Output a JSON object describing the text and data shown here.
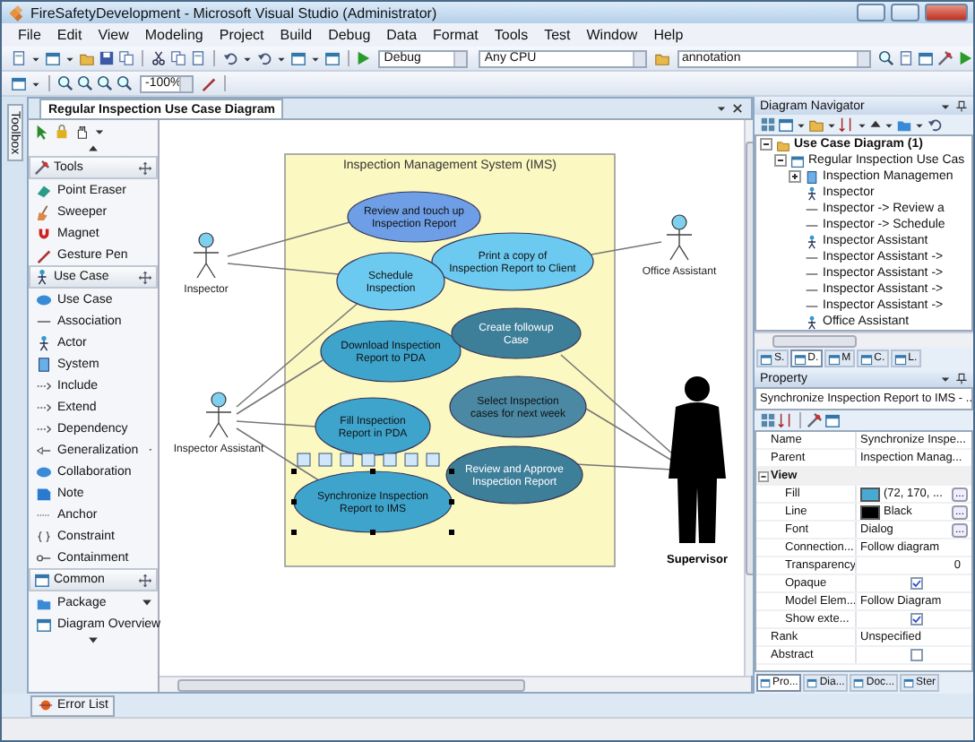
{
  "window": {
    "title": "FireSafetyDevelopment - Microsoft Visual Studio (Administrator)"
  },
  "menu": [
    "File",
    "Edit",
    "View",
    "Modeling",
    "Project",
    "Build",
    "Debug",
    "Data",
    "Format",
    "Tools",
    "Test",
    "Window",
    "Help"
  ],
  "toolbar": {
    "configuration": "Debug",
    "platform": "Any CPU",
    "find": "annotation",
    "zoom": "-100%"
  },
  "toolbox_tab": "Toolbox",
  "document_tab": {
    "title": "Regular Inspection Use Case Diagram"
  },
  "palette": {
    "sections": [
      {
        "title": "Tools",
        "items": [
          {
            "label": "Point Eraser",
            "has_submenu": false
          },
          {
            "label": "Sweeper",
            "has_submenu": false
          },
          {
            "label": "Magnet",
            "has_submenu": false
          },
          {
            "label": "Gesture Pen",
            "has_submenu": false
          }
        ]
      },
      {
        "title": "Use Case",
        "items": [
          {
            "label": "Use Case",
            "has_submenu": false
          },
          {
            "label": "Association",
            "has_submenu": false
          },
          {
            "label": "Actor",
            "has_submenu": false
          },
          {
            "label": "System",
            "has_submenu": false
          },
          {
            "label": "Include",
            "has_submenu": false
          },
          {
            "label": "Extend",
            "has_submenu": false
          },
          {
            "label": "Dependency",
            "has_submenu": false
          },
          {
            "label": "Generalization",
            "has_submenu": true
          },
          {
            "label": "Collaboration",
            "has_submenu": false
          },
          {
            "label": "Note",
            "has_submenu": false
          },
          {
            "label": "Anchor",
            "has_submenu": false
          },
          {
            "label": "Constraint",
            "has_submenu": false
          },
          {
            "label": "Containment",
            "has_submenu": false
          }
        ]
      },
      {
        "title": "Common",
        "items": [
          {
            "label": "Package",
            "has_submenu": true
          },
          {
            "label": "Diagram Overview",
            "has_submenu": false
          }
        ]
      }
    ]
  },
  "diagram": {
    "system_title": "Inspection Management System (IMS)",
    "use_cases": [
      {
        "lines": [
          "Review and touch up",
          "Inspection Report"
        ],
        "color": "#6e9ee6",
        "selected": false
      },
      {
        "lines": [
          "Print a copy of",
          "Inspection Report to Client"
        ],
        "color": "#6ccaf0",
        "selected": false
      },
      {
        "lines": [
          "Schedule",
          "Inspection"
        ],
        "color": "#6ccaf0",
        "selected": false
      },
      {
        "lines": [
          "Download Inspection",
          "Report to PDA"
        ],
        "color": "#3ea4cc",
        "selected": false
      },
      {
        "lines": [
          "Create followup",
          "Case"
        ],
        "color": "#3d7e99",
        "selected": false
      },
      {
        "lines": [
          "Select Inspection",
          "cases for next week"
        ],
        "color": "#4a88a3",
        "selected": false
      },
      {
        "lines": [
          "Fill Inspection",
          "Report in PDA"
        ],
        "color": "#3ea4cc",
        "selected": false
      },
      {
        "lines": [
          "Review and Approve",
          "Inspection Report"
        ],
        "color": "#3d7e99",
        "selected": false
      },
      {
        "lines": [
          "Synchronize Inspection",
          "Report to IMS"
        ],
        "color": "#3ea4cc",
        "selected": true
      }
    ],
    "actors": [
      {
        "name": "Inspector",
        "kind": "stick"
      },
      {
        "name": "Inspector Assistant",
        "kind": "stick"
      },
      {
        "name": "Office Assistant",
        "kind": "stick"
      },
      {
        "name": "Supervisor",
        "kind": "silhouette"
      }
    ]
  },
  "navigator": {
    "title": "Diagram Navigator",
    "tree": [
      {
        "label": "Use Case Diagram (1)",
        "kind": "folder",
        "expanded": true,
        "children": [
          {
            "label": "Regular Inspection Use Cas",
            "kind": "diagram",
            "expanded": true,
            "children": [
              {
                "label": "Inspection Managemen",
                "kind": "system",
                "expanded": false
              },
              {
                "label": "Inspector",
                "kind": "actor"
              },
              {
                "label": "Inspector -> Review a",
                "kind": "association"
              },
              {
                "label": "Inspector -> Schedule",
                "kind": "association"
              },
              {
                "label": "Inspector Assistant",
                "kind": "actor"
              },
              {
                "label": "Inspector Assistant ->",
                "kind": "association"
              },
              {
                "label": "Inspector Assistant ->",
                "kind": "association"
              },
              {
                "label": "Inspector Assistant ->",
                "kind": "association"
              },
              {
                "label": "Inspector Assistant ->",
                "kind": "association"
              },
              {
                "label": "Office Assistant",
                "kind": "actor"
              }
            ]
          }
        ]
      }
    ],
    "tabs": [
      {
        "label": "S.",
        "selected": false
      },
      {
        "label": "D.",
        "selected": true
      },
      {
        "label": "M",
        "selected": false
      },
      {
        "label": "C.",
        "selected": false
      },
      {
        "label": "L.",
        "selected": false
      }
    ]
  },
  "property": {
    "title": "Property",
    "selection": "Synchronize Inspection Report to IMS - ...",
    "rows": [
      {
        "kind": "text",
        "name": "Name",
        "value": "Synchronize Inspe..."
      },
      {
        "kind": "text",
        "name": "Parent",
        "value": "Inspection Manag..."
      },
      {
        "kind": "category",
        "name": "View",
        "expanded": true
      },
      {
        "kind": "color",
        "name": "Fill",
        "value": "(72, 170, ...",
        "color": "#48aad2",
        "button": "..."
      },
      {
        "kind": "color",
        "name": "Line",
        "value": "Black",
        "color": "#000000",
        "button": "..."
      },
      {
        "kind": "text",
        "name": "Font",
        "value": "Dialog",
        "button": "..."
      },
      {
        "kind": "text",
        "name": "Connection...",
        "value": "Follow diagram"
      },
      {
        "kind": "number",
        "name": "Transparency",
        "value": "0"
      },
      {
        "kind": "check",
        "name": "Opaque",
        "checked": true
      },
      {
        "kind": "text",
        "name": "Model Elem...",
        "value": "Follow Diagram"
      },
      {
        "kind": "check",
        "name": "Show exte...",
        "checked": true
      },
      {
        "kind": "text",
        "name": "Rank",
        "value": "Unspecified"
      },
      {
        "kind": "check",
        "name": "Abstract",
        "checked": false
      }
    ],
    "tabs": [
      {
        "label": "Pro...",
        "selected": true
      },
      {
        "label": "Dia...",
        "selected": false
      },
      {
        "label": "Doc...",
        "selected": false
      },
      {
        "label": "Ster",
        "selected": false
      }
    ]
  },
  "bottom_tabs": [
    {
      "label": "Error List"
    }
  ]
}
